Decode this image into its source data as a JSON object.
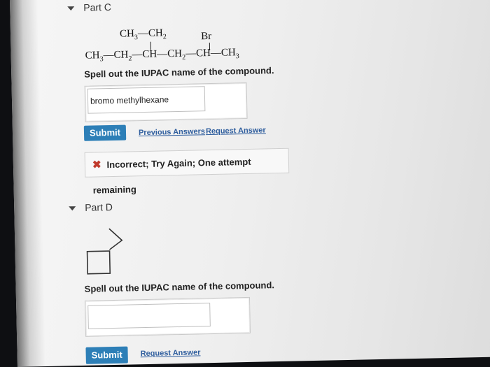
{
  "partC": {
    "title": "Part C",
    "chem": {
      "top_ch3": "CH",
      "top_sub3": "3",
      "top_dash": "—",
      "top_ch2": "CH",
      "top_sub2": "2",
      "br": "Br",
      "main_ch3": "CH",
      "main_sub3a": "3",
      "main_ch2a": "—CH",
      "main_sub2a": "2",
      "main_ch": "—CH—CH",
      "main_sub2b": "2",
      "main_ch_b": "—CH—CH",
      "main_sub3b": "3"
    },
    "prompt": "Spell out the IUPAC name of the compound.",
    "answer": "bromo methylhexane",
    "submit_label": "Submit",
    "previous_answers_label": "Previous Answers",
    "request_answer_label": "Request Answer",
    "feedback": "Incorrect; Try Again; One attempt remaining",
    "feedback_icon": "x-mark-icon"
  },
  "partD": {
    "title": "Part D",
    "prompt": "Spell out the IUPAC name of the compound.",
    "answer": "",
    "submit_label": "Submit",
    "request_answer_label": "Request Answer"
  },
  "colors": {
    "button": "#2d7fb7",
    "link": "#2f5e9e",
    "error": "#c0392b"
  }
}
